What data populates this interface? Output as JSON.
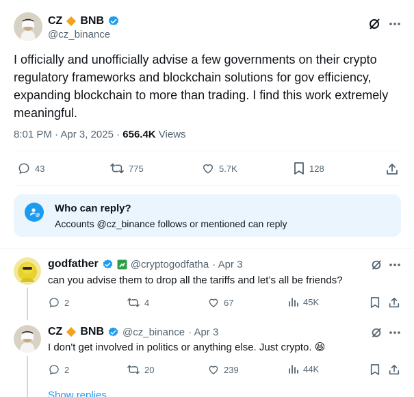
{
  "main_tweet": {
    "author_name": "CZ",
    "affiliation": "BNB",
    "handle": "@cz_binance",
    "text": "I officially and unofficially advise a few governments on their crypto regulatory frameworks and blockchain solutions for gov efficiency, expanding blockchain to more than trading. I find this work extremely meaningful.",
    "time": "8:01 PM · Apr 3, 2025 · ",
    "views_count": "656.4K",
    "views_label": " Views",
    "stats": {
      "replies": "43",
      "reposts": "775",
      "likes": "5.7K",
      "bookmarks": "128"
    }
  },
  "who_can_reply": {
    "title": "Who can reply?",
    "subtitle": "Accounts @cz_binance follows or mentioned can reply"
  },
  "replies": [
    {
      "name": "godfather",
      "handle": "@cryptogodfatha",
      "date": "· Apr 3",
      "text": "can you advise them to drop all the tariffs and let’s all be friends?",
      "replies": "2",
      "reposts": "4",
      "likes": "67",
      "views": "45K"
    },
    {
      "name": "CZ",
      "affiliation": "BNB",
      "handle": "@cz_binance",
      "date": "· Apr 3",
      "text": "I don't get involved in politics or anything else. Just crypto. 😆",
      "replies": "2",
      "reposts": "20",
      "likes": "239",
      "views": "44K"
    }
  ],
  "show_replies": "Show replies",
  "colors": {
    "verified": "#1d9bf0",
    "bnb": "#f3a21b",
    "link": "#1d9bf0",
    "muted": "#536471"
  }
}
